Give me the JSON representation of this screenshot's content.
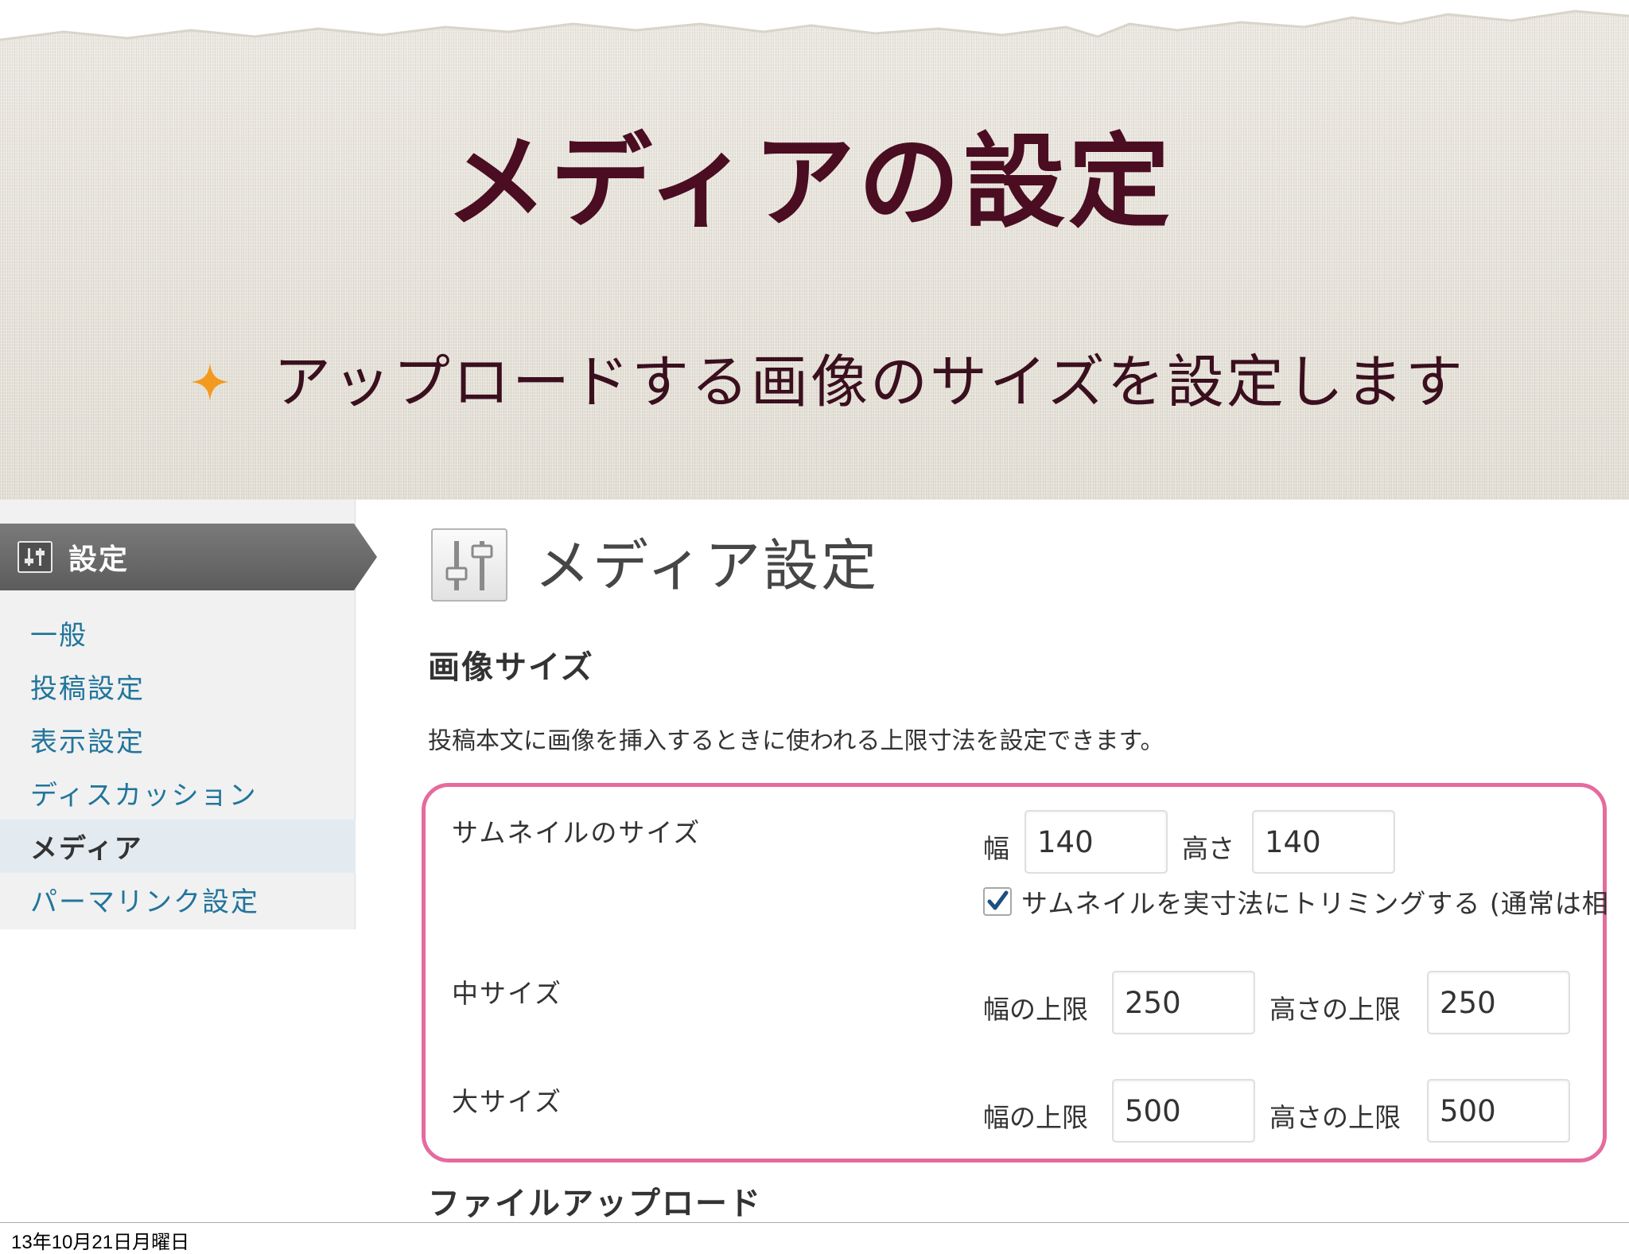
{
  "slide": {
    "title": "メディアの設定",
    "bullet": "アップロードする画像のサイズを設定します",
    "bullet_icon": "four-point-star-icon",
    "accent_color": "#f39a1e",
    "title_color": "#4a0d22"
  },
  "sidebar": {
    "menu_label": "設定",
    "menu_icon": "settings-sliders-icon",
    "items": [
      {
        "label": "一般"
      },
      {
        "label": "投稿設定"
      },
      {
        "label": "表示設定"
      },
      {
        "label": "ディスカッション"
      },
      {
        "label": "メディア",
        "active": true
      },
      {
        "label": "パーマリンク設定"
      }
    ],
    "link_color": "#21759b"
  },
  "main": {
    "page_title": "メディア設定",
    "page_icon": "settings-sliders-icon",
    "section_title": "画像サイズ",
    "section_desc": "投稿本文に画像を挿入するときに使われる上限寸法を設定できます。",
    "highlight_color": "#e56b9e",
    "thumbnail": {
      "label": "サムネイルのサイズ",
      "width_label": "幅",
      "width": "140",
      "height_label": "高さ",
      "height": "140",
      "crop_checked": true,
      "crop_label": "サムネイルを実寸法にトリミングする (通常は相"
    },
    "medium": {
      "label": "中サイズ",
      "width_label": "幅の上限",
      "width": "250",
      "height_label": "高さの上限",
      "height": "250"
    },
    "large": {
      "label": "大サイズ",
      "width_label": "幅の上限",
      "width": "500",
      "height_label": "高さの上限",
      "height": "500"
    },
    "next_section_title": "ファイルアップロード"
  },
  "footer": {
    "date": "13年10月21日月曜日"
  }
}
